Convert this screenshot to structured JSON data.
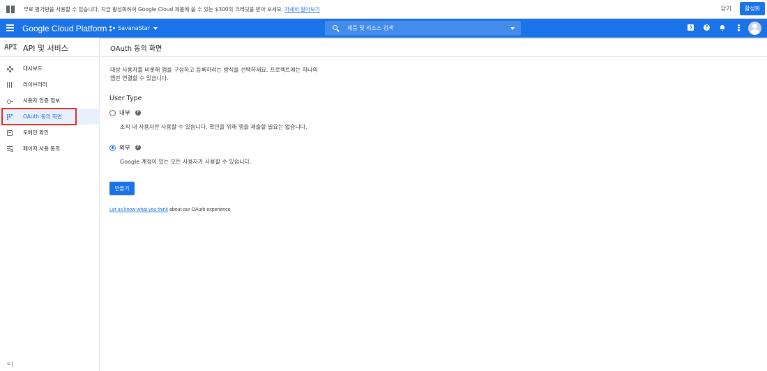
{
  "promo": {
    "message": "무료 평가판을 사용할 수 있습니다. 지금 활성화하여 Google Cloud 제품에 쓸 수 있는 $300의 크레딧을 받아 보세요.",
    "link": "자세히 알아보기",
    "close_label": "닫기",
    "activate_label": "활성화"
  },
  "header": {
    "brand": "Google Cloud Platform",
    "project": "SavanaStar",
    "search_placeholder": "제품 및 리소스 검색",
    "help_glyph": "?"
  },
  "sidebar": {
    "logo": "API",
    "title": "API 및 서비스",
    "items": [
      {
        "label": "대시보드",
        "icon": "dashboard-icon"
      },
      {
        "label": "라이브러리",
        "icon": "library-icon"
      },
      {
        "label": "사용자 인증 정보",
        "icon": "key-icon"
      },
      {
        "label": "OAuth 동의 화면",
        "icon": "oauth-icon"
      },
      {
        "label": "도메인 확인",
        "icon": "domain-icon"
      },
      {
        "label": "페이지 사용 동의",
        "icon": "pages-icon"
      }
    ],
    "collapse_glyph": "<|"
  },
  "main": {
    "title": "OAuth 동의 화면",
    "description": "대상 사용자를 비롯해 앱을 구성하고 등록하려는 방식을 선택하세요. 프로젝트에는 하나의 앱만 연결할 수 있습니다.",
    "user_type_heading": "User Type",
    "options": [
      {
        "label": "내부",
        "description": "조직 내 사용자만 사용할 수 있습니다. 확인을 위해 앱을 제출할 필요는 없습니다.",
        "checked": false
      },
      {
        "label": "외부",
        "description": "Google 계정이 있는 모든 사용자가 사용할 수 있습니다.",
        "checked": true
      }
    ],
    "help_glyph": "?",
    "create_label": "만들기",
    "feedback_link": "Let us know what you think",
    "feedback_rest": " about our OAuth experience"
  },
  "colors": {
    "primary": "#1a73e8",
    "highlight": "#d93025",
    "active_bg": "#e8f0fe"
  }
}
